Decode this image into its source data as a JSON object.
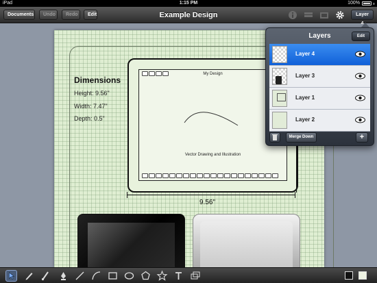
{
  "status_bar": {
    "carrier": "iPad",
    "time": "1:15 PM",
    "battery": "100%"
  },
  "toolbar": {
    "documents_label": "Documents",
    "undo_label": "Undo",
    "redo_label": "Redo",
    "edit_label": "Edit",
    "title": "Example Design",
    "icons": [
      "info-icon",
      "layers-stack-icon",
      "export-icon",
      "gear-icon"
    ],
    "layer_button_label": "Layer 4"
  },
  "canvas": {
    "dimensions_heading": "Dimensions",
    "height_text": "Height: 9.56\"",
    "width_text": "Width: 7.47\"",
    "depth_text": "Depth: 0.5\"",
    "screen_title": "My Design",
    "screen_caption": "Vector Drawing and Illustration",
    "measure_label": "9.56\""
  },
  "layers_panel": {
    "title": "Layers",
    "edit_label": "Edit",
    "layers": [
      {
        "name": "Layer 4",
        "selected": true,
        "visible": true
      },
      {
        "name": "Layer 3",
        "selected": false,
        "visible": true
      },
      {
        "name": "Layer 1",
        "selected": false,
        "visible": true
      },
      {
        "name": "Layer 2",
        "selected": false,
        "visible": true
      }
    ],
    "merge_label": "Merge Down",
    "add_label": "+"
  },
  "bottom_tools": [
    "select-arrow-icon",
    "pencil-icon",
    "brush-icon",
    "pen-nib-icon",
    "line-icon",
    "curve-icon",
    "rectangle-icon",
    "ellipse-icon",
    "polygon-icon",
    "star-icon",
    "text-icon",
    "image-icon"
  ],
  "colors": {
    "accent": "#1a6fe2",
    "paper": "#dfeed2",
    "toolbar": "#2c2c2c"
  }
}
